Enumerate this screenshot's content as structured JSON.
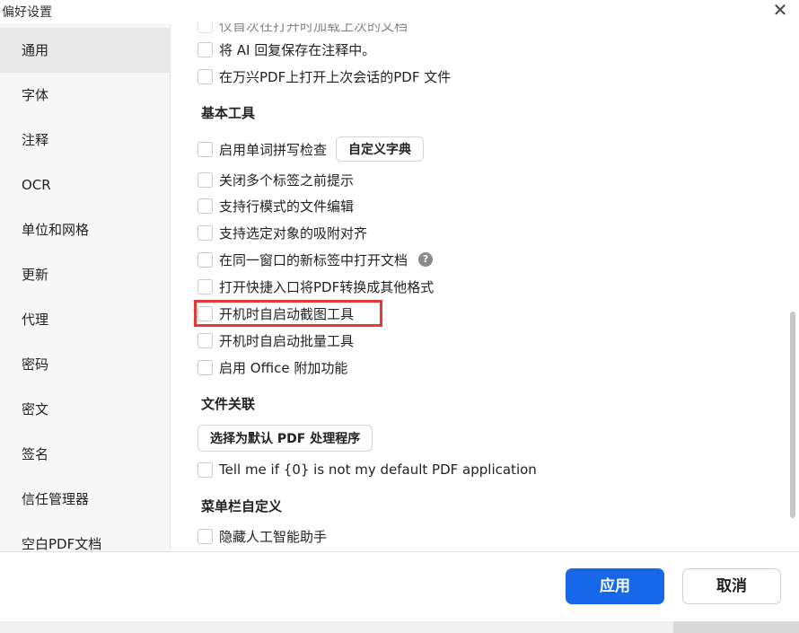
{
  "window": {
    "title": "偏好设置",
    "close_symbol": "✕"
  },
  "sidebar": {
    "items": [
      {
        "label": "通用",
        "active": true
      },
      {
        "label": "字体"
      },
      {
        "label": "注释"
      },
      {
        "label": "OCR"
      },
      {
        "label": "单位和网格"
      },
      {
        "label": "更新"
      },
      {
        "label": "代理"
      },
      {
        "label": "密码"
      },
      {
        "label": "密文"
      },
      {
        "label": "签名"
      },
      {
        "label": "信任管理器"
      },
      {
        "label": "空白PDF文档"
      }
    ]
  },
  "general": {
    "partial_top_label": "仅首次在打开时加载上次的文档",
    "ai_save_label": "将 AI 回复保存在注释中。",
    "reopen_label": "在万兴PDF上打开上次会话的PDF 文件"
  },
  "basic_tools": {
    "title": "基本工具",
    "spell_check_label": "启用单词拼写检查",
    "custom_dict_button": "自定义字典",
    "prompt_close_tabs_label": "关闭多个标签之前提示",
    "line_mode_edit_label": "支持行模式的文件编辑",
    "snap_align_label": "支持选定对象的吸附对齐",
    "same_window_tab_label": "在同一窗口的新标签中打开文档",
    "help_symbol": "?",
    "quick_convert_label": "打开快捷入口将PDF转换成其他格式",
    "auto_screenshot_label": "开机时自启动截图工具",
    "auto_batch_label": "开机时自启动批量工具",
    "office_addin_label": "启用 Office 附加功能"
  },
  "file_assoc": {
    "title": "文件关联",
    "default_pdf_button": "选择为默认 PDF 处理程序",
    "tell_me_label": "Tell me if {0} is not my default PDF application"
  },
  "menubar": {
    "title": "菜单栏自定义",
    "hide_ai_label": "隐藏人工智能助手"
  },
  "footer": {
    "apply": "应用",
    "cancel": "取消"
  },
  "colors": {
    "accent": "#1668e8",
    "highlight": "#e53935"
  }
}
